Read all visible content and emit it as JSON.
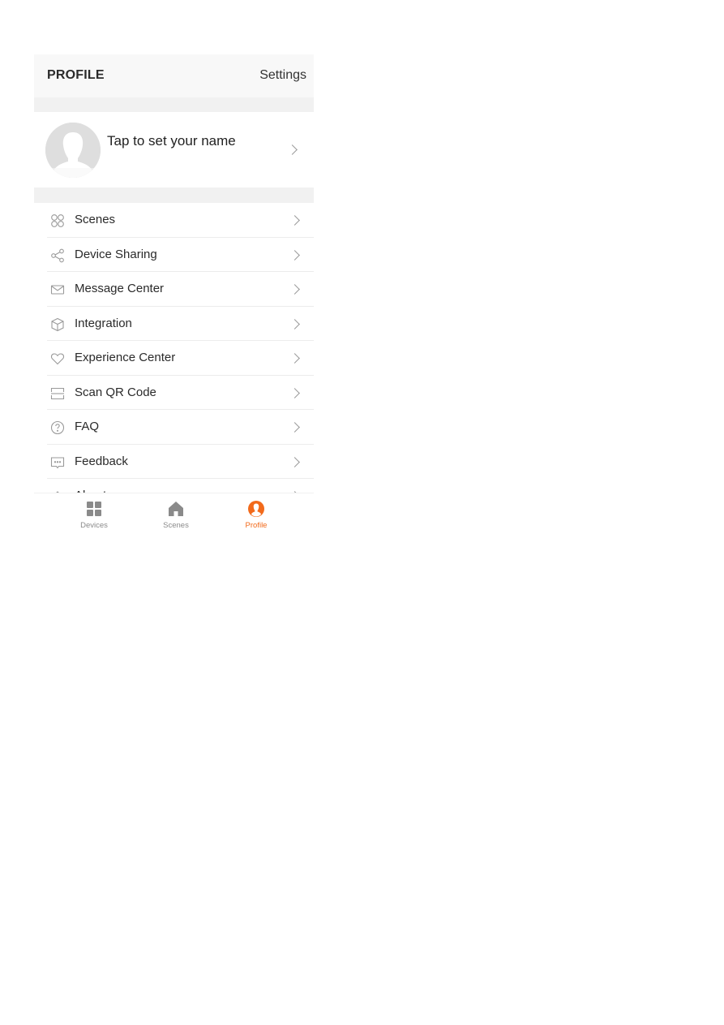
{
  "header": {
    "title": "PROFILE",
    "settings_label": "Settings"
  },
  "profile": {
    "name_prompt": "Tap to set your name",
    "avatar_icon": "default-avatar-icon"
  },
  "menu": {
    "items": [
      {
        "label": "Scenes",
        "icon": "scenes-grid-icon"
      },
      {
        "label": "Device Sharing",
        "icon": "share-icon"
      },
      {
        "label": "Message Center",
        "icon": "envelope-icon"
      },
      {
        "label": "Integration",
        "icon": "cube-icon"
      },
      {
        "label": "Experience Center",
        "icon": "heart-icon"
      },
      {
        "label": "Scan QR Code",
        "icon": "scan-icon"
      },
      {
        "label": "FAQ",
        "icon": "question-circle-icon"
      },
      {
        "label": "Feedback",
        "icon": "feedback-bubble-icon"
      },
      {
        "label": "About",
        "icon": "about-icon"
      }
    ]
  },
  "tabbar": {
    "tabs": [
      {
        "label": "Devices",
        "icon": "devices-grid-icon",
        "active": false
      },
      {
        "label": "Scenes",
        "icon": "home-icon",
        "active": false
      },
      {
        "label": "Profile",
        "icon": "profile-icon",
        "active": true
      }
    ]
  },
  "colors": {
    "accent": "#f26a1b",
    "header_bg": "#f8f8f8",
    "band_bg": "#f1f1f1",
    "icon_gray": "#9a9a9a",
    "tab_inactive": "#8a8a8a"
  }
}
